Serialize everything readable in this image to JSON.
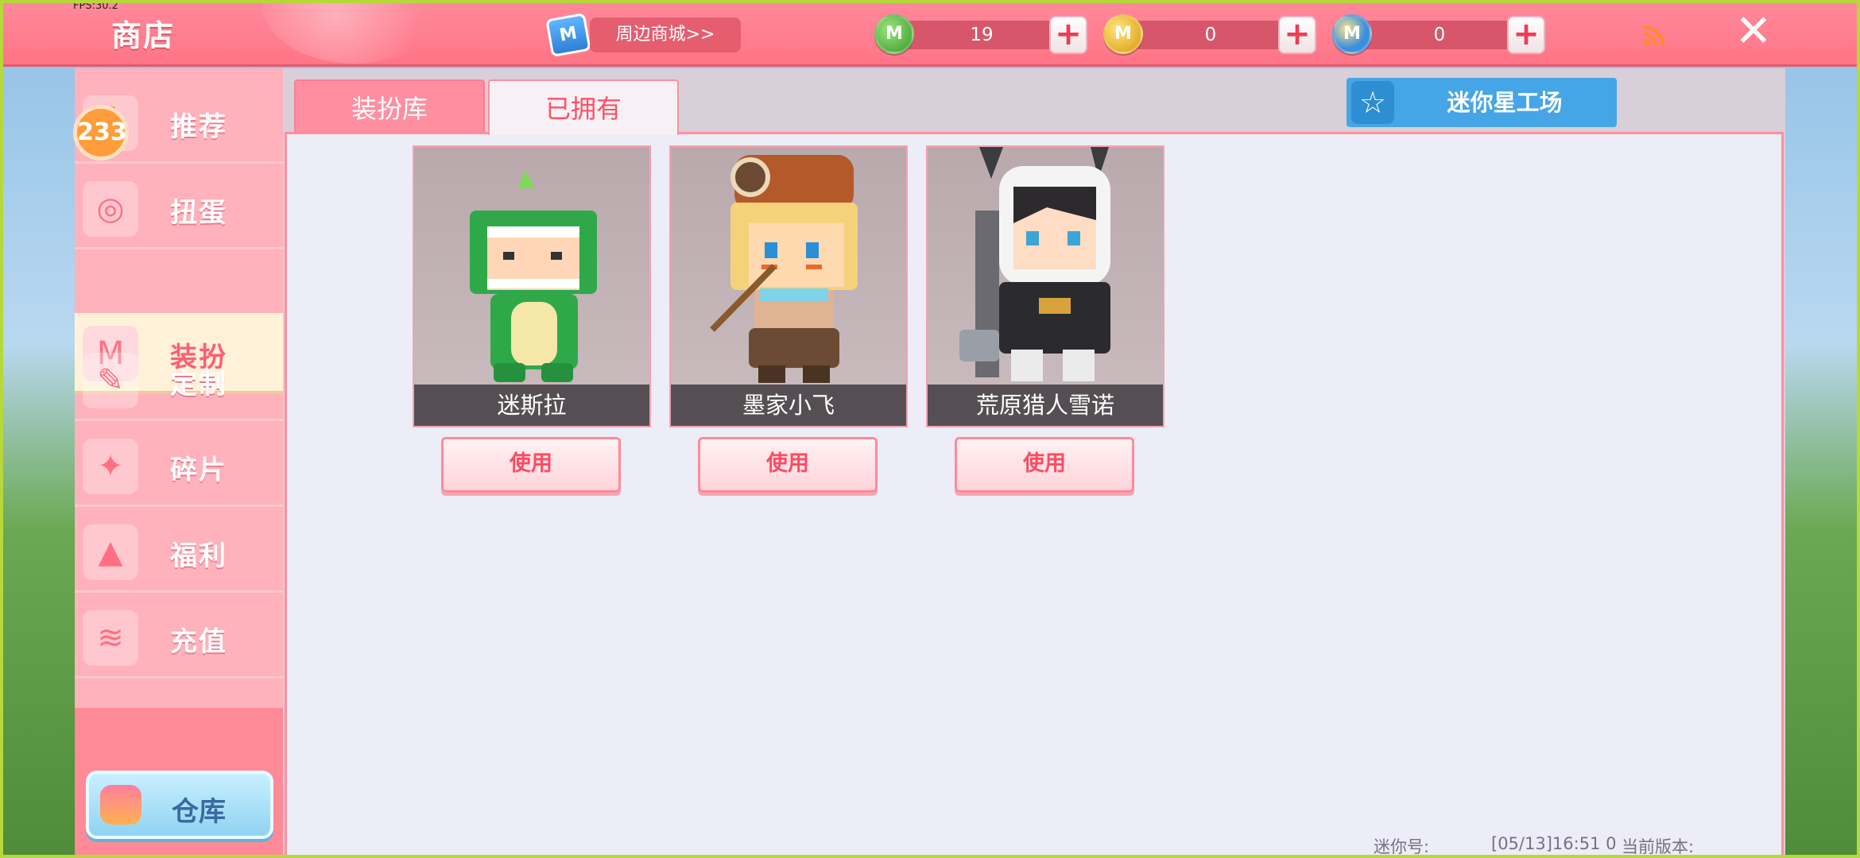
{
  "fps_text": "FPS:30.2",
  "header": {
    "title": "商店",
    "mall_label": "周边商城>>",
    "mall_icon_letter": "M",
    "currencies": [
      {
        "name": "green-gem",
        "value": "19",
        "color": "#4caf3c",
        "letter": "M"
      },
      {
        "name": "gold-coin",
        "value": "0",
        "color": "#e8b31c",
        "letter": "M"
      },
      {
        "name": "blue-coin",
        "value": "0",
        "color": "#3b97e0",
        "letter": "M"
      }
    ],
    "plus_symbol": "+",
    "close_symbol": "✕"
  },
  "sidebar": {
    "badge_count": "233",
    "items": [
      {
        "label": "推荐",
        "icon": "thumb-icon",
        "glyph": "👍"
      },
      {
        "label": "扭蛋",
        "icon": "gacha-icon",
        "glyph": "◎"
      },
      {
        "label": "装扮",
        "icon": "shirt-icon",
        "glyph": "M",
        "active": true
      },
      {
        "label": "定制",
        "icon": "pencil-ruler-icon",
        "glyph": "✎"
      },
      {
        "label": "碎片",
        "icon": "fragment-icon",
        "glyph": "✦"
      },
      {
        "label": "福利",
        "icon": "gift-icon",
        "glyph": "▲"
      },
      {
        "label": "充值",
        "icon": "coin-stack-icon",
        "glyph": "≋"
      }
    ],
    "warehouse_label": "仓库"
  },
  "main": {
    "tabs": [
      {
        "label": "装扮库",
        "selected": false
      },
      {
        "label": "已拥有",
        "selected": true
      }
    ],
    "workshop_label": "迷你星工场",
    "skins": [
      {
        "name": "迷斯拉",
        "button": "使用"
      },
      {
        "name": "墨家小飞",
        "button": "使用"
      },
      {
        "name": "荒原猎人雪诺",
        "button": "使用"
      }
    ]
  },
  "footer": {
    "mini_id_label": "迷你号:",
    "datetime": "[05/13]16:51 0",
    "version_label": "当前版本:"
  },
  "colors": {
    "topbar": "#ff7c8e",
    "sidebar": "#ffb2bb",
    "active_tab_text": "#ff4f68",
    "workshop": "#45a5e6",
    "badge": "#ff9d3a"
  }
}
